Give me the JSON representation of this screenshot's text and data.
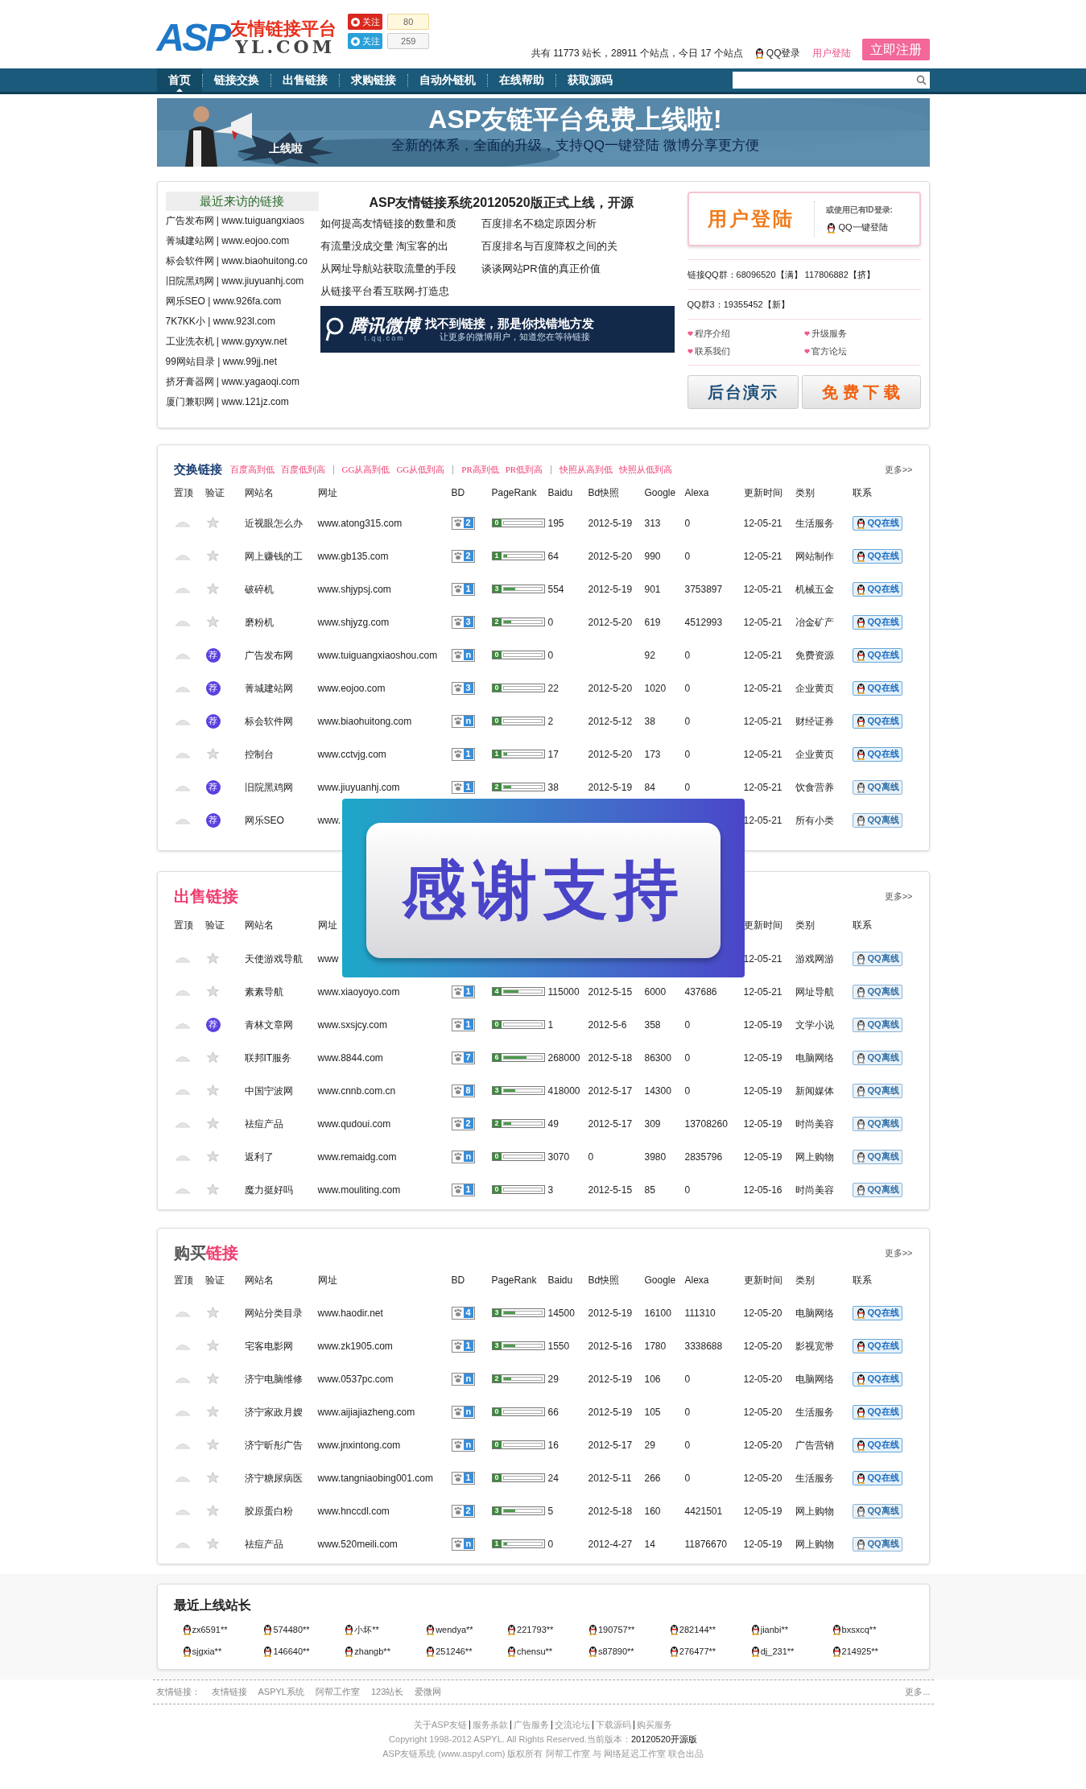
{
  "header": {
    "logo": {
      "mark": "ASP",
      "title": "友情链接平台",
      "domain": "YL.COM"
    },
    "follow": [
      {
        "kind": "weibo",
        "label": "关注",
        "count": "80"
      },
      {
        "kind": "tencent",
        "label": "关注",
        "count": "259"
      }
    ],
    "stats": "共有 11773 站长，28911 个站点，今日 17 个站点",
    "qq_login": "QQ登录",
    "user_login": "用户登陆",
    "register": "立即注册"
  },
  "nav": [
    {
      "label": "首页",
      "selected": true
    },
    {
      "label": "链接交换",
      "selected": false
    },
    {
      "label": "出售链接",
      "selected": false
    },
    {
      "label": "求购链接",
      "selected": false
    },
    {
      "label": "自动外链机",
      "selected": false
    },
    {
      "label": "在线帮助",
      "selected": false
    },
    {
      "label": "获取源码",
      "selected": false
    }
  ],
  "banner": {
    "headline": "ASP友链平台免费上线啦!",
    "subtitle": "全新的体系，全面的升级，支持QQ一键登陆 微博分享更方便",
    "badge": "上线啦"
  },
  "recent_links": {
    "title": "最近来访的链接",
    "items": [
      "广告发布网 | www.tuiguangxiaos",
      "菁城建站网 | www.eojoo.com",
      "标会软件网 | www.biaohuitong.co",
      "旧院黑鸡网 | www.jiuyuanhj.com",
      "网乐SEO | www.926fa.com",
      "7K7KK小 | www.923l.com",
      "工业洗衣机 | www.gyxyw.net",
      "99网站目录 | www.99jj.net",
      "挤牙膏器网 | www.yagaoqi.com",
      "厦门兼职网 | www.121jz.com"
    ]
  },
  "news": {
    "headline": "ASP友情链接系统20120520版正式上线，开源",
    "articles": [
      "如何提高友情链接的数量和质",
      "百度排名不稳定原因分析",
      "有流量没成交量 淘宝客的出",
      "百度排名与百度降权之间的关",
      "从网址导航站获取流量的手段",
      "谈谈网站PR值的真正价值",
      "从链接平台看互联网-打造忠"
    ],
    "weibo_banner": {
      "brand": "腾讯微博",
      "domain": "t.qq.com",
      "slogan": "找不到链接，那是你找错地方发",
      "sub": "让更多的微博用户，知道您在等待链接"
    }
  },
  "login": {
    "title": "用户登陆",
    "alt": "或使用已有ID登录:",
    "qq": "QQ一键登陆",
    "groups": [
      "链接QQ群：68096520【满】 117806882【挤】",
      "QQ群3：19355452【新】"
    ],
    "links": [
      "程序介绍",
      "升级服务",
      "联系我们",
      "官方论坛"
    ],
    "demo": "后台演示",
    "download": "免 费 下 载"
  },
  "exchange": {
    "title_parts": [
      {
        "text": "交换链接",
        "color": "#1b3f73"
      }
    ],
    "sorts": [
      [
        "百度高到低",
        "百度低到高"
      ],
      [
        "GG从高到低",
        "GG从低到高"
      ],
      [
        "PR高到低",
        "PR低到高"
      ],
      [
        "快照从高到低",
        "快照从低到高"
      ]
    ],
    "more": "更多>>",
    "columns": {
      "top": "置顶",
      "verify": "验证",
      "name": "网站名",
      "url": "网址",
      "bd": "BD",
      "pr": "PageRank",
      "baidu": "Baidu",
      "snapshot": "Bd快照",
      "google": "Google",
      "alexa": "Alexa",
      "updated": "更新时间",
      "category": "类别",
      "contact": "联系"
    },
    "rows": [
      {
        "verify": {
          "kind": "star"
        },
        "name": "近视眼怎么办",
        "url": "www.atong315.com",
        "bd": "2",
        "pr": {
          "value": "0",
          "level": 0
        },
        "baidu": "195",
        "snapshot": "2012-5-19",
        "google": "313",
        "alexa": "0",
        "updated": "12-05-21",
        "category": "生活服务",
        "contact": {
          "label": "QQ在线",
          "online": true
        }
      },
      {
        "verify": {
          "kind": "star"
        },
        "name": "网上赚钱的工",
        "url": "www.gb135.com",
        "bd": "2",
        "pr": {
          "value": "1",
          "level": 0.1
        },
        "baidu": "64",
        "snapshot": "2012-5-20",
        "google": "990",
        "alexa": "0",
        "updated": "12-05-21",
        "category": "网站制作",
        "contact": {
          "label": "QQ在线",
          "online": true
        }
      },
      {
        "verify": {
          "kind": "star"
        },
        "name": "破碎机",
        "url": "www.shjypsj.com",
        "bd": "1",
        "pr": {
          "value": "3",
          "level": 0.3
        },
        "baidu": "554",
        "snapshot": "2012-5-19",
        "google": "901",
        "alexa": "3753897",
        "updated": "12-05-21",
        "category": "机械五金",
        "contact": {
          "label": "QQ在线",
          "online": true
        }
      },
      {
        "verify": {
          "kind": "star"
        },
        "name": "磨粉机",
        "url": "www.shjyzg.com",
        "bd": "3",
        "pr": {
          "value": "2",
          "level": 0.2
        },
        "baidu": "0",
        "snapshot": "2012-5-20",
        "google": "619",
        "alexa": "4512993",
        "updated": "12-05-21",
        "category": "冶金矿产",
        "contact": {
          "label": "QQ在线",
          "online": true
        }
      },
      {
        "verify": {
          "kind": "recommend",
          "label": "荐"
        },
        "name": "广告发布网",
        "url": "www.tuiguangxiaoshou.com",
        "bd": "n",
        "pr": {
          "value": "0",
          "level": 0
        },
        "baidu": "0",
        "google": "92",
        "alexa": "0",
        "updated": "12-05-21",
        "category": "免费资源",
        "contact": {
          "label": "QQ在线",
          "online": true
        }
      },
      {
        "verify": {
          "kind": "recommend",
          "label": "荐"
        },
        "name": "菁城建站网",
        "url": "www.eojoo.com",
        "bd": "3",
        "pr": {
          "value": "0",
          "level": 0
        },
        "baidu": "22",
        "snapshot": "2012-5-20",
        "google": "1020",
        "alexa": "0",
        "updated": "12-05-21",
        "category": "企业黄页",
        "contact": {
          "label": "QQ在线",
          "online": true
        }
      },
      {
        "verify": {
          "kind": "recommend",
          "label": "荐"
        },
        "name": "标会软件网",
        "url": "www.biaohuitong.com",
        "bd": "n",
        "pr": {
          "value": "0",
          "level": 0
        },
        "baidu": "2",
        "snapshot": "2012-5-12",
        "google": "38",
        "alexa": "0",
        "updated": "12-05-21",
        "category": "财经证券",
        "contact": {
          "label": "QQ在线",
          "online": true
        }
      },
      {
        "verify": {
          "kind": "star"
        },
        "name": "控制台",
        "url": "www.cctvjg.com",
        "bd": "1",
        "pr": {
          "value": "1",
          "level": 0.1
        },
        "baidu": "17",
        "snapshot": "2012-5-20",
        "google": "173",
        "alexa": "0",
        "updated": "12-05-21",
        "category": "企业黄页",
        "contact": {
          "label": "QQ在线",
          "online": true
        }
      },
      {
        "verify": {
          "kind": "recommend",
          "label": "荐"
        },
        "name": "旧院黑鸡网",
        "url": "www.jiuyuanhj.com",
        "bd": "1",
        "pr": {
          "value": "2",
          "level": 0.2
        },
        "baidu": "38",
        "snapshot": "2012-5-19",
        "google": "84",
        "alexa": "0",
        "updated": "12-05-21",
        "category": "饮食营养",
        "contact": {
          "label": "QQ离线",
          "online": false
        }
      },
      {
        "verify": {
          "kind": "recommend",
          "label": "荐"
        },
        "name": "网乐SEO",
        "url": "www.",
        "updated": "12-05-21",
        "category": "所有小类",
        "contact": {
          "label": "QQ离线",
          "online": false
        }
      }
    ]
  },
  "sale": {
    "title_parts": [
      {
        "text": "出售链接",
        "color": "#f03c6e"
      }
    ],
    "more": "更多>>",
    "columns": {
      "top": "置顶",
      "verify": "验证",
      "name": "网站名",
      "url": "网址",
      "updated": "更新时间",
      "category": "类别",
      "contact": "联系"
    },
    "rows": [
      {
        "verify": {
          "kind": "star"
        },
        "name": "天使游戏导航",
        "url": "www",
        "updated": "12-05-21",
        "category": "游戏网游",
        "contact": {
          "label": "QQ离线",
          "online": false
        }
      },
      {
        "verify": {
          "kind": "star"
        },
        "name": "素素导航",
        "url": "www.xiaoyoyo.com",
        "bd": "1",
        "pr": {
          "value": "4",
          "level": 0.4
        },
        "baidu": "115000",
        "snapshot": "2012-5-15",
        "google": "6000",
        "alexa": "437686",
        "updated": "12-05-21",
        "category": "网址导航",
        "contact": {
          "label": "QQ离线",
          "online": false
        }
      },
      {
        "verify": {
          "kind": "recommend",
          "label": "荐"
        },
        "name": "青林文章网",
        "url": "www.sxsjcy.com",
        "bd": "1",
        "pr": {
          "value": "0",
          "level": 0
        },
        "baidu": "1",
        "snapshot": "2012-5-6",
        "google": "358",
        "alexa": "0",
        "updated": "12-05-19",
        "category": "文学小说",
        "contact": {
          "label": "QQ离线",
          "online": false
        }
      },
      {
        "verify": {
          "kind": "star"
        },
        "name": "联邦IT服务",
        "url": "www.8844.com",
        "bd": "7",
        "pr": {
          "value": "6",
          "level": 0.6
        },
        "baidu": "268000",
        "snapshot": "2012-5-18",
        "google": "86300",
        "alexa": "0",
        "updated": "12-05-19",
        "category": "电脑网络",
        "contact": {
          "label": "QQ离线",
          "online": false
        }
      },
      {
        "verify": {
          "kind": "star"
        },
        "name": "中国宁波网",
        "url": "www.cnnb.com.cn",
        "bd": "8",
        "pr": {
          "value": "3",
          "level": 0.3
        },
        "baidu": "418000",
        "snapshot": "2012-5-17",
        "google": "14300",
        "alexa": "0",
        "updated": "12-05-19",
        "category": "新闻媒体",
        "contact": {
          "label": "QQ离线",
          "online": false
        }
      },
      {
        "verify": {
          "kind": "star"
        },
        "name": "祛痘产品",
        "url": "www.qudoui.com",
        "bd": "2",
        "pr": {
          "value": "2",
          "level": 0.2
        },
        "baidu": "49",
        "snapshot": "2012-5-17",
        "google": "309",
        "alexa": "13708260",
        "updated": "12-05-19",
        "category": "时尚美容",
        "contact": {
          "label": "QQ离线",
          "online": false
        }
      },
      {
        "verify": {
          "kind": "star"
        },
        "name": "返利了",
        "url": "www.remaidg.com",
        "bd": "n",
        "pr": {
          "value": "0",
          "level": 0
        },
        "baidu": "3070",
        "snapshot": "0",
        "google": "3980",
        "alexa": "2835796",
        "updated": "12-05-19",
        "category": "网上购物",
        "contact": {
          "label": "QQ离线",
          "online": false
        }
      },
      {
        "verify": {
          "kind": "star"
        },
        "name": "魔力挺好吗",
        "url": "www.mouliting.com",
        "bd": "1",
        "pr": {
          "value": "0",
          "level": 0
        },
        "baidu": "3",
        "snapshot": "2012-5-15",
        "google": "85",
        "alexa": "0",
        "updated": "12-05-16",
        "category": "时尚美容",
        "contact": {
          "label": "QQ离线",
          "online": false
        }
      }
    ]
  },
  "buy": {
    "title_parts": [
      {
        "text": "购买",
        "color": "#555555"
      },
      {
        "text": "链接",
        "color": "#f03c6e"
      }
    ],
    "more": "更多>>",
    "columns": {
      "top": "置顶",
      "verify": "验证",
      "name": "网站名",
      "url": "网址",
      "bd": "BD",
      "pr": "PageRank",
      "baidu": "Baidu",
      "snapshot": "Bd快照",
      "google": "Google",
      "alexa": "Alexa",
      "updated": "更新时间",
      "category": "类别",
      "contact": "联系"
    },
    "rows": [
      {
        "verify": {
          "kind": "star"
        },
        "name": "网站分类目录",
        "url": "www.haodir.net",
        "bd": "4",
        "pr": {
          "value": "3",
          "level": 0.3
        },
        "baidu": "14500",
        "snapshot": "2012-5-19",
        "google": "16100",
        "alexa": "111310",
        "updated": "12-05-20",
        "category": "电脑网络",
        "contact": {
          "label": "QQ在线",
          "online": true
        }
      },
      {
        "verify": {
          "kind": "star"
        },
        "name": "宅客电影网",
        "url": "www.zk1905.com",
        "bd": "1",
        "pr": {
          "value": "3",
          "level": 0.3
        },
        "baidu": "1550",
        "snapshot": "2012-5-16",
        "google": "1780",
        "alexa": "3338688",
        "updated": "12-05-20",
        "category": "影视宽带",
        "contact": {
          "label": "QQ在线",
          "online": true
        }
      },
      {
        "verify": {
          "kind": "star"
        },
        "name": "济宁电脑维修",
        "url": "www.0537pc.com",
        "bd": "n",
        "pr": {
          "value": "2",
          "level": 0.2
        },
        "baidu": "29",
        "snapshot": "2012-5-19",
        "google": "106",
        "alexa": "0",
        "updated": "12-05-20",
        "category": "电脑网络",
        "contact": {
          "label": "QQ在线",
          "online": true
        }
      },
      {
        "verify": {
          "kind": "star"
        },
        "name": "济宁家政月嫂",
        "url": "www.aijiajiazheng.com",
        "bd": "n",
        "pr": {
          "value": "0",
          "level": 0
        },
        "baidu": "66",
        "snapshot": "2012-5-19",
        "google": "105",
        "alexa": "0",
        "updated": "12-05-20",
        "category": "生活服务",
        "contact": {
          "label": "QQ在线",
          "online": true
        }
      },
      {
        "verify": {
          "kind": "star"
        },
        "name": "济宁昕彤广告",
        "url": "www.jnxintong.com",
        "bd": "n",
        "pr": {
          "value": "0",
          "level": 0
        },
        "baidu": "16",
        "snapshot": "2012-5-17",
        "google": "29",
        "alexa": "0",
        "updated": "12-05-20",
        "category": "广告营销",
        "contact": {
          "label": "QQ在线",
          "online": true
        }
      },
      {
        "verify": {
          "kind": "star"
        },
        "name": "济宁糖尿病医",
        "url": "www.tangniaobing001.com",
        "bd": "1",
        "pr": {
          "value": "0",
          "level": 0
        },
        "baidu": "24",
        "snapshot": "2012-5-11",
        "google": "266",
        "alexa": "0",
        "updated": "12-05-20",
        "category": "生活服务",
        "contact": {
          "label": "QQ在线",
          "online": true
        }
      },
      {
        "verify": {
          "kind": "star"
        },
        "name": "胶原蛋白粉",
        "url": "www.hnccdl.com",
        "bd": "2",
        "pr": {
          "value": "3",
          "level": 0.3
        },
        "baidu": "5",
        "snapshot": "2012-5-18",
        "google": "160",
        "alexa": "4421501",
        "updated": "12-05-19",
        "category": "网上购物",
        "contact": {
          "label": "QQ离线",
          "online": false
        }
      },
      {
        "verify": {
          "kind": "star"
        },
        "name": "祛痘产品",
        "url": "www.520meili.com",
        "bd": "n",
        "pr": {
          "value": "1",
          "level": 0.1
        },
        "baidu": "0",
        "snapshot": "2012-4-27",
        "google": "14",
        "alexa": "11876670",
        "updated": "12-05-19",
        "category": "网上购物",
        "contact": {
          "label": "QQ离线",
          "online": false
        }
      }
    ]
  },
  "online_users": {
    "title": "最近上线站长",
    "users": [
      "zx6591**",
      "574480**",
      "小坏**",
      "wendya**",
      "221793**",
      "190757**",
      "282144**",
      "jianbi**",
      "bxsxcq**",
      "sjgxia**",
      "146640**",
      "zhangb**",
      "251246**",
      "chensu**",
      "s87890**",
      "276477**",
      "dj_231**",
      "214925**"
    ]
  },
  "footer": {
    "friend_label": "友情链接：",
    "friend_links": [
      "友情链接",
      "ASPYL系统",
      "阿帮工作室",
      "123站长",
      "爱微网"
    ],
    "more": "更多...",
    "links": [
      "关于ASP友链",
      "服务条款",
      "广告服务",
      "交流论坛",
      "下载源码",
      "购买服务"
    ],
    "copyright": "Copyright 1998-2012 ASPYL. All Rights Reserved.当前版本：",
    "version": "20120520开源版",
    "credits": "ASP友链系统 (www.aspyl.com) 版权所有 阿帮工作室 与 网络延迟工作室 联合出品"
  },
  "popup": {
    "text": "感谢支持"
  }
}
